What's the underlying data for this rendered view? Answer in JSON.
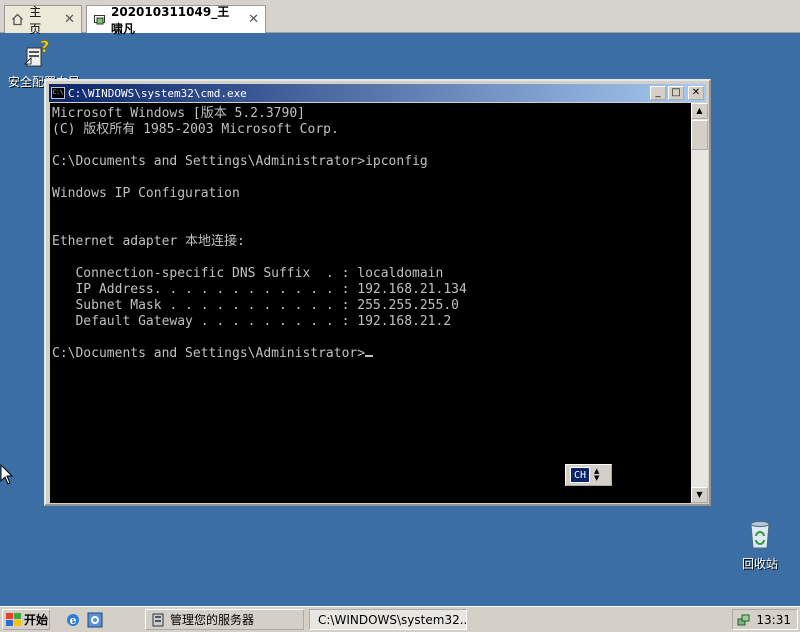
{
  "tabs": [
    {
      "label": "主页",
      "icon": "home-icon"
    },
    {
      "label": "202010311049_王啸凡",
      "icon": "vm-icon"
    }
  ],
  "desktop": {
    "icons": [
      {
        "label": "安全配置向导",
        "icon": "security-wizard-icon"
      },
      {
        "label": "回收站",
        "icon": "recycle-bin-icon"
      }
    ]
  },
  "cmd_window": {
    "title": "C:\\WINDOWS\\system32\\cmd.exe",
    "lines": [
      "Microsoft Windows [版本 5.2.3790]",
      "(C) 版权所有 1985-2003 Microsoft Corp.",
      "",
      "C:\\Documents and Settings\\Administrator>ipconfig",
      "",
      "Windows IP Configuration",
      "",
      "",
      "Ethernet adapter 本地连接:",
      "",
      "   Connection-specific DNS Suffix  . : localdomain",
      "   IP Address. . . . . . . . . . . . : 192.168.21.134",
      "   Subnet Mask . . . . . . . . . . . : 255.255.255.0",
      "   Default Gateway . . . . . . . . . : 192.168.21.2",
      "",
      "C:\\Documents and Settings\\Administrator>"
    ],
    "ime_label": "CH"
  },
  "taskbar": {
    "start_label": "开始",
    "tasks": [
      {
        "label": "管理您的服务器",
        "icon": "server-manager-icon"
      },
      {
        "label": "C:\\WINDOWS\\system32...",
        "icon": "cmd-icon"
      }
    ],
    "clock": "13:31"
  }
}
